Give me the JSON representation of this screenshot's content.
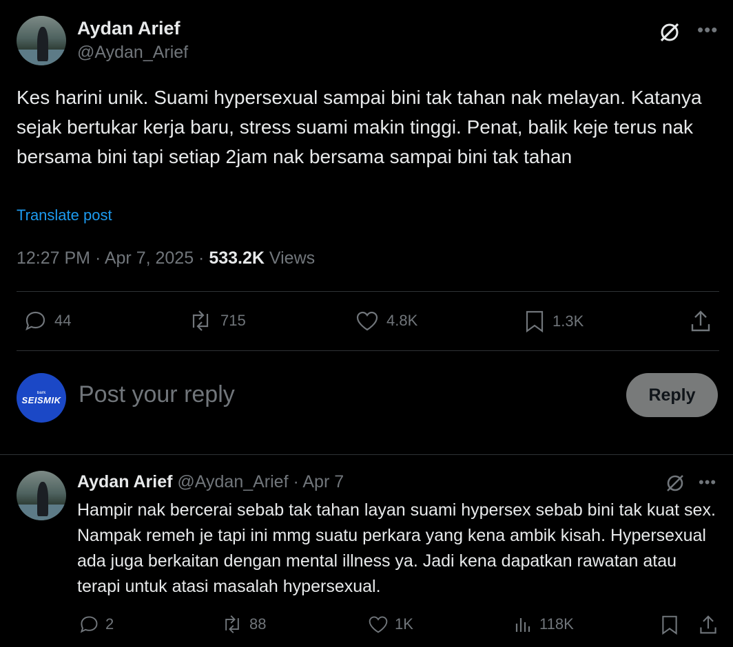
{
  "post": {
    "author_name": "Aydan Arief",
    "author_handle": "@Aydan_Arief",
    "text": "Kes harini unik. Suami hypersexual sampai bini tak tahan nak melayan. Katanya sejak bertukar kerja baru, stress suami makin tinggi. Penat, balik keje terus nak bersama bini tapi setiap 2jam nak bersama sampai bini tak tahan",
    "translate_label": "Translate post",
    "time": "12:27 PM · Apr 7, 2025 · ",
    "views_count": "533.2K",
    "views_label": " Views",
    "actions": {
      "replies": "44",
      "reposts": "715",
      "likes": "4.8K",
      "bookmarks": "1.3K"
    }
  },
  "reply_composer": {
    "avatar_label": "SEISMIK",
    "avatar_sublabel": "bark",
    "placeholder": "Post your reply",
    "button_label": "Reply"
  },
  "reply": {
    "author_name": "Aydan Arief",
    "author_handle": "@Aydan_Arief",
    "date": "· Apr 7",
    "text": "Hampir nak bercerai sebab tak tahan layan suami hypersex sebab bini tak kuat sex. Nampak remeh je tapi ini mmg suatu perkara yang kena ambik kisah. Hypersexual ada juga berkaitan dengan mental illness ya. Jadi kena dapatkan rawatan atau terapi untuk atasi masalah hypersexual.",
    "actions": {
      "replies": "2",
      "reposts": "88",
      "likes": "1K",
      "views": "118K"
    }
  },
  "icons": {
    "grok": "grok-icon",
    "more": "more-icon",
    "reply": "reply-icon",
    "repost": "repost-icon",
    "like": "like-icon",
    "bookmark": "bookmark-icon",
    "share": "share-icon",
    "views": "views-icon"
  },
  "colors": {
    "background": "#000000",
    "text": "#e7e9ea",
    "secondary": "#71767b",
    "link": "#1d9bf0",
    "divider": "#2f3336",
    "reply_button": "#787a7a",
    "seismik_blue": "#1b48c6"
  }
}
